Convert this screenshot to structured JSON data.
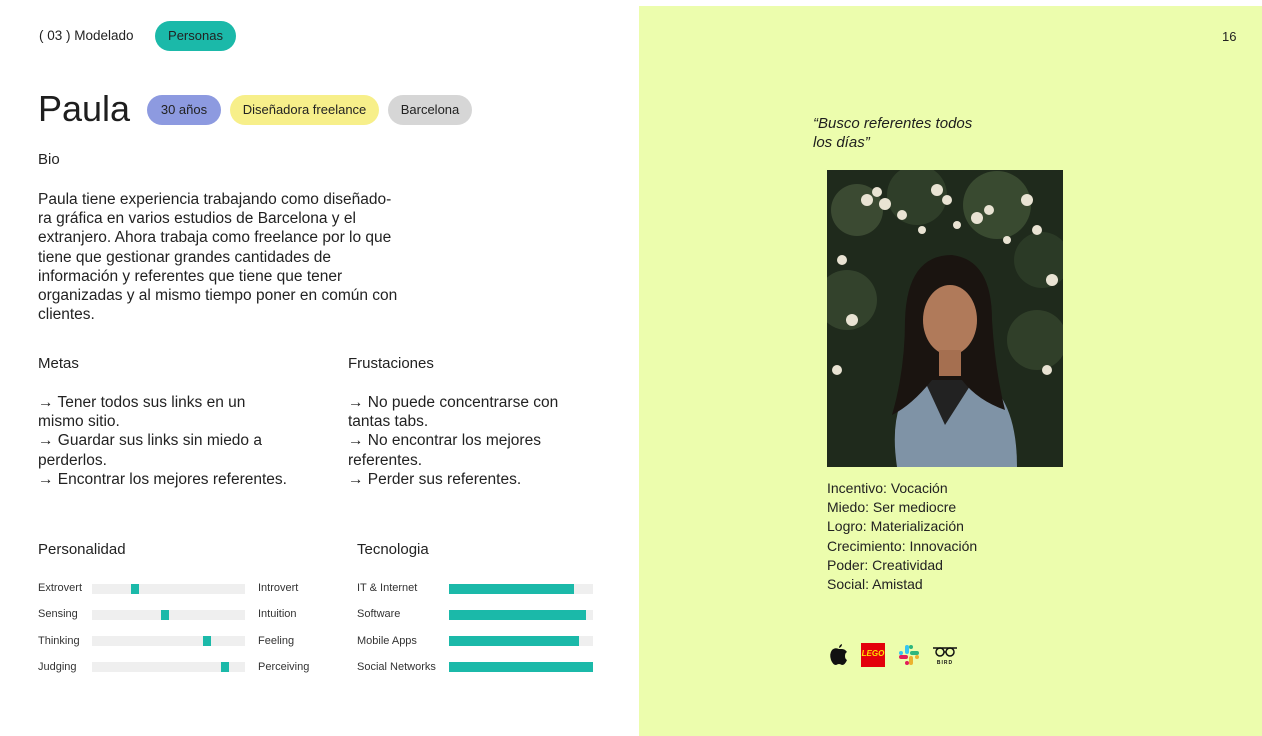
{
  "header": {
    "breadcrumb": "( 03 ) Modelado",
    "section_tag": "Personas",
    "section_tag_color": "#1bb9a9"
  },
  "persona": {
    "name": "Paula",
    "tags": [
      {
        "label": "30 años",
        "color": "#8d9ae0"
      },
      {
        "label": "Diseñadora freelance",
        "color": "#f7ef8a"
      },
      {
        "label": "Barcelona",
        "color": "#d6d6d6"
      }
    ]
  },
  "bio": {
    "title": "Bio",
    "lines": [
      "Paula tiene experiencia trabajando como diseñado-",
      "ra gráfica en varios estudios de Barcelona y el",
      "extranjero. Ahora trabaja como freelance por lo que",
      "tiene que gestionar grandes cantidades de",
      "información y referentes que tiene que tener",
      "organizadas y al mismo tiempo poner en común con",
      "clientes."
    ]
  },
  "goals": {
    "title": "Metas",
    "lines": [
      "→ Tener todos sus links en un",
      "mismo sitio.",
      "→ Guardar sus links sin miedo a",
      "perderlos.",
      "→ Encontrar los mejores referentes."
    ]
  },
  "frustrations": {
    "title": "Frustaciones",
    "lines": [
      "→ No puede concentrarse con",
      "tantas tabs.",
      "→ No encontrar los mejores",
      "referentes.",
      "→ Perder sus referentes."
    ]
  },
  "personality": {
    "title": "Personalidad",
    "scales": [
      {
        "left": "Extrovert",
        "right": "Introvert",
        "value": 0.28
      },
      {
        "left": "Sensing",
        "right": "Intuition",
        "value": 0.48
      },
      {
        "left": "Thinking",
        "right": "Feeling",
        "value": 0.75
      },
      {
        "left": "Judging",
        "right": "Perceiving",
        "value": 0.87
      }
    ]
  },
  "technology": {
    "title": "Tecnologia",
    "items": [
      {
        "label": "IT & Internet",
        "value": 0.87
      },
      {
        "label": "Software",
        "value": 0.95
      },
      {
        "label": "Mobile Apps",
        "value": 0.9
      },
      {
        "label": "Social Networks",
        "value": 1.0
      }
    ]
  },
  "page_number": "16",
  "quote": {
    "lines": [
      "“Busco referentes todos",
      "los días”"
    ]
  },
  "attributes": [
    "Incentivo: Vocación",
    "Miedo: Ser mediocre",
    "Logro: Materialización",
    "Crecimiento: Innovación",
    "Poder: Creatividad",
    "Social: Amistad"
  ],
  "brands": {
    "icons": [
      "apple-icon",
      "lego-icon",
      "slack-icon",
      "bird-icon"
    ],
    "lego_text": "LEGO",
    "bird_text": "BIRD"
  },
  "colors": {
    "accent": "#1bb9a9",
    "panel": "#ecfdad"
  }
}
